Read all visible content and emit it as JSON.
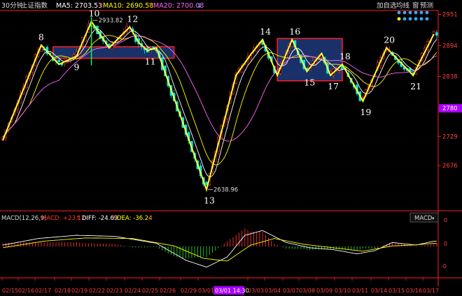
{
  "header": {
    "period": "30分钟",
    "index_name": "上证指数",
    "ma5_label": "MA5: 2703.53",
    "ma5_arrow": "↑",
    "ma10_label": "MA10: 2690.58",
    "ma10_arrow": "↑",
    "ma20_label": "MA20: 2700.08",
    "ma20_arrow": "↓"
  },
  "toolbar": {
    "buttons": [
      "加自选",
      "均线",
      "窗",
      "预测"
    ]
  },
  "macd": {
    "title": "MACD(12,26,9)",
    "macd_label": "MACD: +23.12",
    "macd_arrow": "↑",
    "diff_label": "DIFF: -24.69",
    "diff_arrow": "↑",
    "dea_label": "DEA: -36.24",
    "dea_arrow": "↑",
    "selector": "MACD",
    "axis_ticks": [
      "0",
      "0",
      "-0"
    ]
  },
  "colors": {
    "up": "#ff3232",
    "down": "#00e5e5",
    "ma5": "#ffffff",
    "ma10": "#ffff00",
    "ma20": "#ff66ff",
    "wave": "#ffff33",
    "box_fill": "#1d3a7a",
    "box_border": "#ff2020",
    "axis": "#ff2020",
    "price_text": "#ff4040",
    "highlight": "#aa00ff"
  },
  "chart_data": {
    "type": "candlestick",
    "y_range": [
      2596,
      2958
    ],
    "y_ticks": [
      2951,
      2894,
      2838,
      2780,
      2729,
      2676
    ],
    "highlight_price": 2780,
    "x_labels": [
      "02/15",
      "02/16",
      "02/17",
      "02/18",
      "02/19",
      "02/22",
      "02/23",
      "02/24",
      "02/25",
      "02/26",
      "02/29",
      "03/01",
      "03/01 14:30",
      "03/03",
      "03/04",
      "03/07",
      "03/08",
      "03/09",
      "03/10",
      "03/11",
      "03/14",
      "03/15",
      "03/16",
      "03/17"
    ],
    "highlight_x_label": "03/01 14:30",
    "wave_points": [
      {
        "bar": 0,
        "price": 2722
      },
      {
        "bar": 13,
        "price": 2895,
        "label": "8"
      },
      {
        "bar": 19,
        "price": 2860
      },
      {
        "bar": 25,
        "price": 2875,
        "label": "9"
      },
      {
        "bar": 30,
        "price": 2938,
        "label": "10"
      },
      {
        "bar": 36,
        "price": 2890
      },
      {
        "bar": 43,
        "price": 2928,
        "label": "12"
      },
      {
        "bar": 46,
        "price": 2900
      },
      {
        "bar": 49,
        "price": 2885,
        "label": "11"
      },
      {
        "bar": 52,
        "price": 2890
      },
      {
        "bar": 69,
        "price": 2632,
        "label": "13"
      },
      {
        "bar": 79,
        "price": 2840
      },
      {
        "bar": 84,
        "price": 2878
      },
      {
        "bar": 88,
        "price": 2905,
        "label": "14"
      },
      {
        "bar": 93,
        "price": 2840
      },
      {
        "bar": 98,
        "price": 2905,
        "label": "16"
      },
      {
        "bar": 103,
        "price": 2847,
        "label": "15"
      },
      {
        "bar": 108,
        "price": 2880
      },
      {
        "bar": 111,
        "price": 2840,
        "label": "17"
      },
      {
        "bar": 115,
        "price": 2860,
        "label": "18"
      },
      {
        "bar": 122,
        "price": 2793,
        "label": "19"
      },
      {
        "bar": 130,
        "price": 2890,
        "label": "20"
      },
      {
        "bar": 139,
        "price": 2840,
        "label": "21"
      },
      {
        "bar": 146,
        "price": 2915
      }
    ],
    "annotations": [
      {
        "text": "2933.82",
        "bar": 30,
        "price": 2940
      },
      {
        "text": "2638.96",
        "bar": 69,
        "price": 2632
      }
    ],
    "boxes": [
      {
        "bar_start": 17,
        "bar_end": 58,
        "price_top": 2892,
        "price_bottom": 2871
      },
      {
        "bar_start": 93,
        "bar_end": 115,
        "price_top": 2907,
        "price_bottom": 2830
      }
    ],
    "macd_range": [
      -1,
      1
    ],
    "macd_diff_points": [
      {
        "bar": 0,
        "v": 0.05
      },
      {
        "bar": 12,
        "v": 0.3
      },
      {
        "bar": 25,
        "v": 0.42
      },
      {
        "bar": 38,
        "v": 0.38
      },
      {
        "bar": 52,
        "v": 0.12
      },
      {
        "bar": 62,
        "v": -0.52
      },
      {
        "bar": 69,
        "v": -0.78
      },
      {
        "bar": 76,
        "v": -0.4
      },
      {
        "bar": 82,
        "v": 0.42
      },
      {
        "bar": 88,
        "v": 0.6
      },
      {
        "bar": 96,
        "v": 0.15
      },
      {
        "bar": 104,
        "v": -0.05
      },
      {
        "bar": 112,
        "v": -0.12
      },
      {
        "bar": 120,
        "v": -0.28
      },
      {
        "bar": 126,
        "v": -0.16
      },
      {
        "bar": 132,
        "v": 0.15
      },
      {
        "bar": 140,
        "v": 0.05
      },
      {
        "bar": 146,
        "v": 0.2
      }
    ],
    "macd_dea_points": [
      {
        "bar": 0,
        "v": -0.05
      },
      {
        "bar": 14,
        "v": 0.2
      },
      {
        "bar": 28,
        "v": 0.32
      },
      {
        "bar": 44,
        "v": 0.3
      },
      {
        "bar": 58,
        "v": 0.02
      },
      {
        "bar": 68,
        "v": -0.45
      },
      {
        "bar": 76,
        "v": -0.55
      },
      {
        "bar": 84,
        "v": 0.05
      },
      {
        "bar": 92,
        "v": 0.3
      },
      {
        "bar": 102,
        "v": 0.08
      },
      {
        "bar": 112,
        "v": -0.05
      },
      {
        "bar": 122,
        "v": -0.18
      },
      {
        "bar": 132,
        "v": 0.02
      },
      {
        "bar": 140,
        "v": 0.06
      },
      {
        "bar": 146,
        "v": 0.12
      }
    ]
  }
}
